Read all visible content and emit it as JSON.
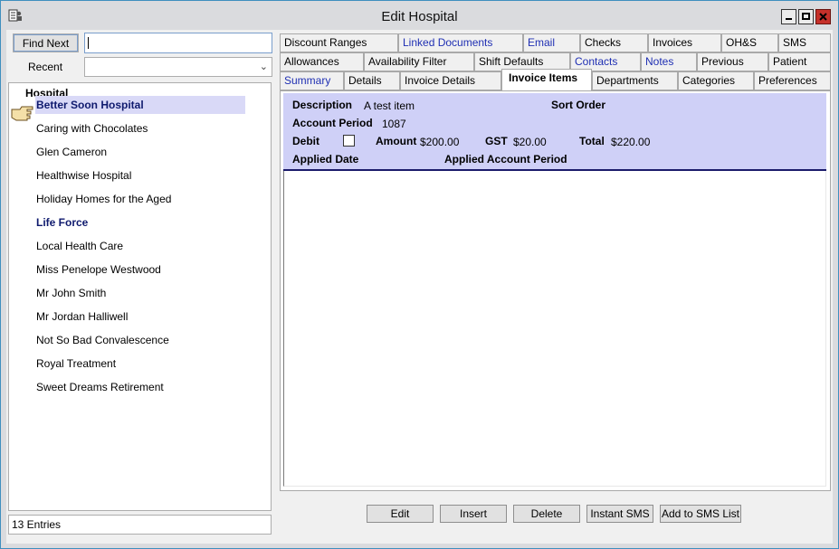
{
  "window": {
    "title": "Edit Hospital"
  },
  "left": {
    "find_next_label": "Find Next",
    "search_value": "",
    "recent_label": "Recent",
    "recent_value": "",
    "list_header": "Hospital",
    "items": [
      {
        "label": "Better Soon Hospital"
      },
      {
        "label": "Caring with Chocolates"
      },
      {
        "label": "Glen Cameron"
      },
      {
        "label": "Healthwise Hospital"
      },
      {
        "label": "Holiday Homes for the Aged"
      },
      {
        "label": "Life Force"
      },
      {
        "label": "Local Health Care"
      },
      {
        "label": "Miss Penelope Westwood"
      },
      {
        "label": "Mr John Smith"
      },
      {
        "label": "Mr Jordan Halliwell"
      },
      {
        "label": "Not So Bad Convalescence"
      },
      {
        "label": "Royal Treatment"
      },
      {
        "label": "Sweet Dreams Retirement"
      }
    ],
    "status": "13 Entries"
  },
  "tabs": {
    "row1": [
      "Discount Ranges",
      "Linked Documents",
      "Email",
      "Checks",
      "Invoices",
      "OH&S",
      "SMS"
    ],
    "row2": [
      "Allowances",
      "Availability Filter",
      "Shift Defaults",
      "Contacts",
      "Notes",
      "Previous",
      "Patient"
    ],
    "row3": [
      "Summary",
      "Details",
      "Invoice Details",
      "Invoice Items",
      "Departments",
      "Categories",
      "Preferences"
    ]
  },
  "invoice": {
    "description_label": "Description",
    "description_value": "A test item",
    "sort_order_label": "Sort Order",
    "account_period_label": "Account Period",
    "account_period_value": "1087",
    "debit_label": "Debit",
    "debit_checked": false,
    "amount_label": "Amount",
    "amount_value": "$200.00",
    "gst_label": "GST",
    "gst_value": "$20.00",
    "total_label": "Total",
    "total_value": "$220.00",
    "applied_date_label": "Applied Date",
    "applied_account_period_label": "Applied Account Period"
  },
  "buttons": {
    "edit": "Edit",
    "insert": "Insert",
    "delete": "Delete",
    "instant_sms": "Instant SMS",
    "add_to_sms_list": "Add to SMS List"
  },
  "colors": {
    "accent_panel": "#cfd0f7",
    "link": "#1f2fb3",
    "selected_row": "#d9d9f7"
  }
}
